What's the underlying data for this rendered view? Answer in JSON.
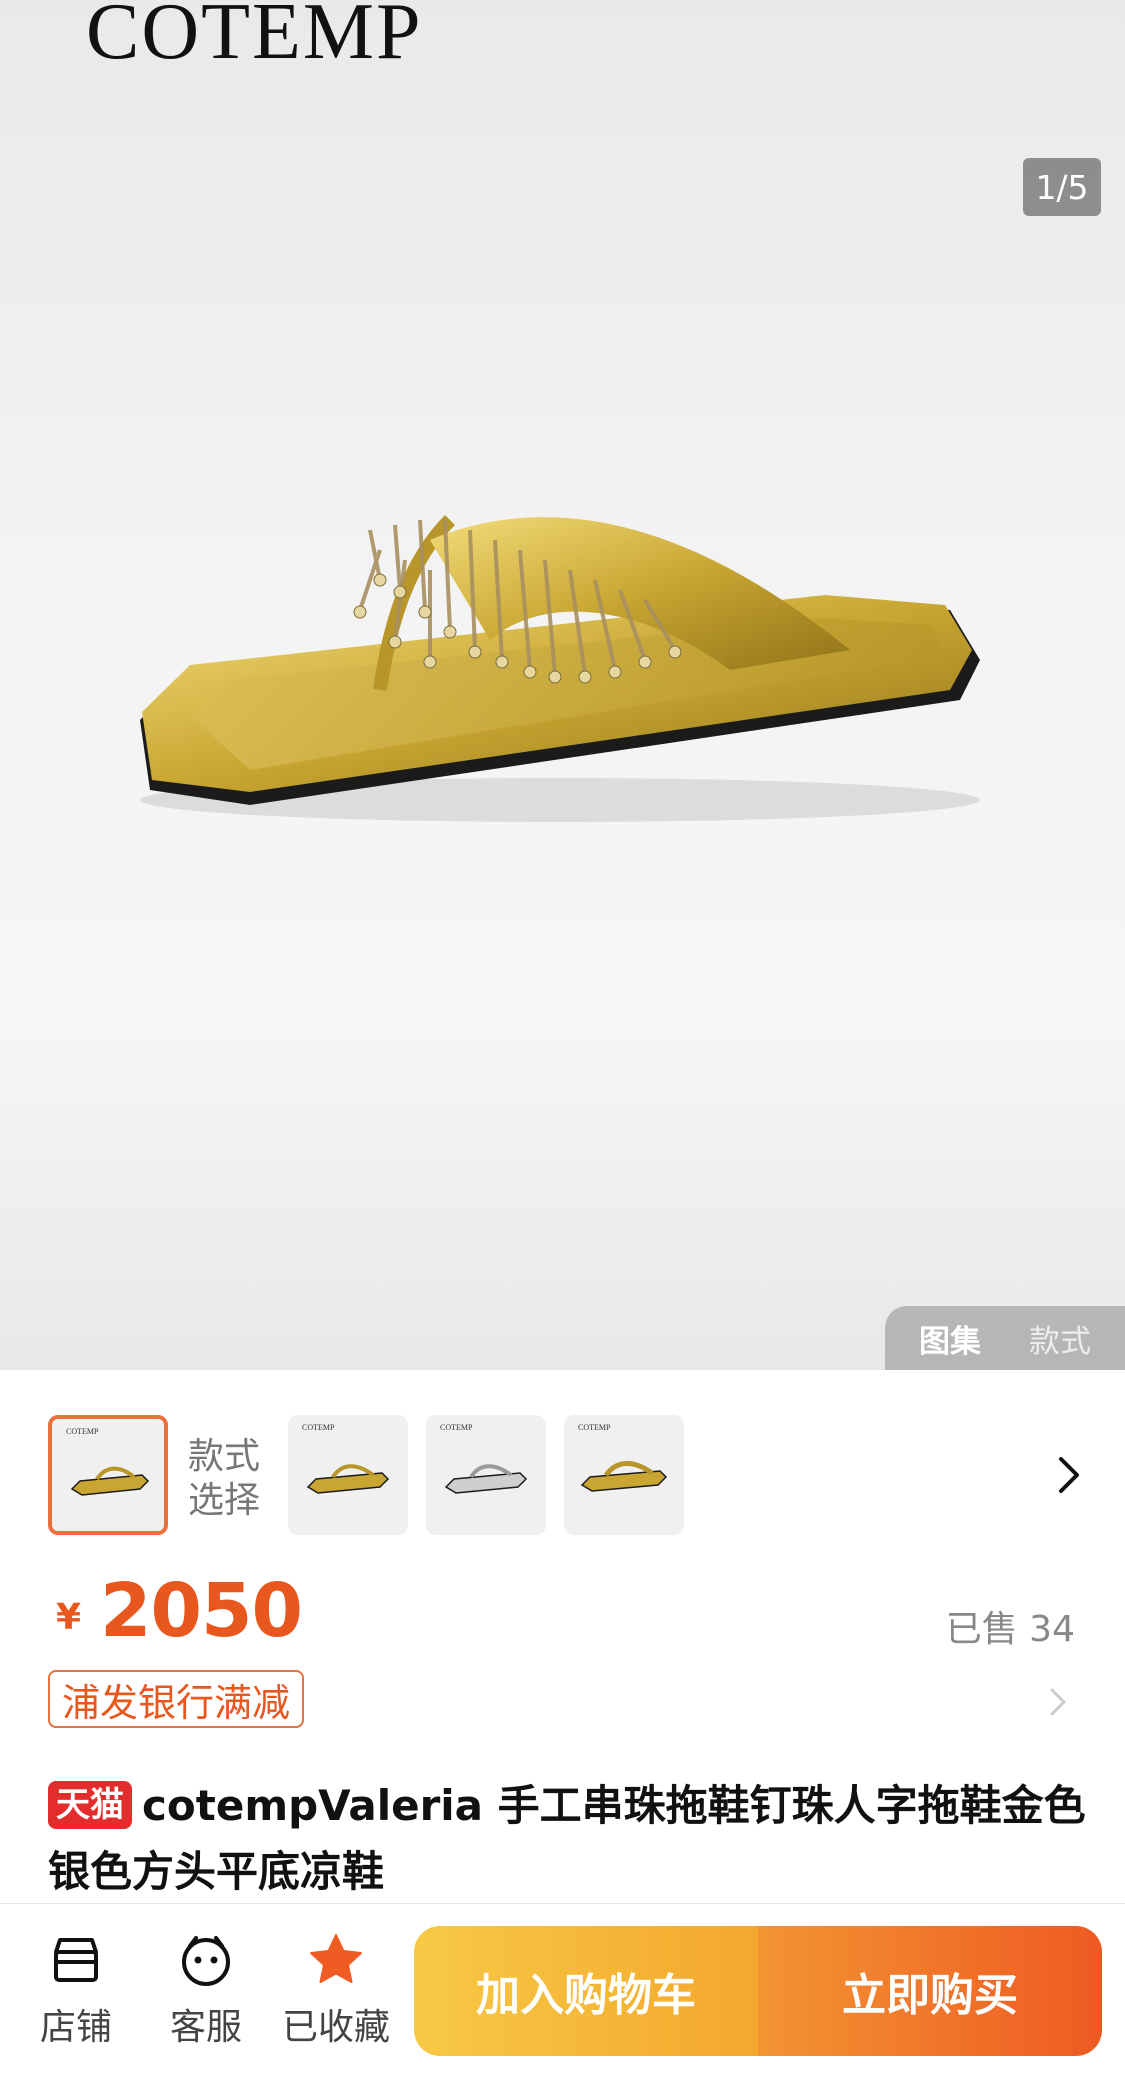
{
  "gallery": {
    "brand": "COTEMP",
    "counter": "1/5",
    "tabs": [
      "图集",
      "款式"
    ]
  },
  "variants": {
    "label": "款式选择",
    "thumb_brand": "COTEMP",
    "thumbs": [
      {
        "color": "gold",
        "selected": true
      },
      {
        "color": "gold",
        "selected": false
      },
      {
        "color": "silver",
        "selected": false
      },
      {
        "color": "gold",
        "selected": false
      }
    ]
  },
  "price": {
    "currency": "¥",
    "amount": "2050",
    "sold": "已售 34"
  },
  "promo": {
    "label": "浦发银行满减"
  },
  "product": {
    "badge": "天猫",
    "title": "cotempValeria 手工串珠拖鞋钉珠人字拖鞋金色银色方头平底凉鞋"
  },
  "bottom_bar": {
    "store": "店铺",
    "service": "客服",
    "favorite": "已收藏",
    "add_to_cart": "加入购物车",
    "buy_now": "立即购买"
  },
  "colors": {
    "accent": "#e8581e",
    "tmall_red": "#e32c2c",
    "favorite_orange": "#f05a23"
  }
}
